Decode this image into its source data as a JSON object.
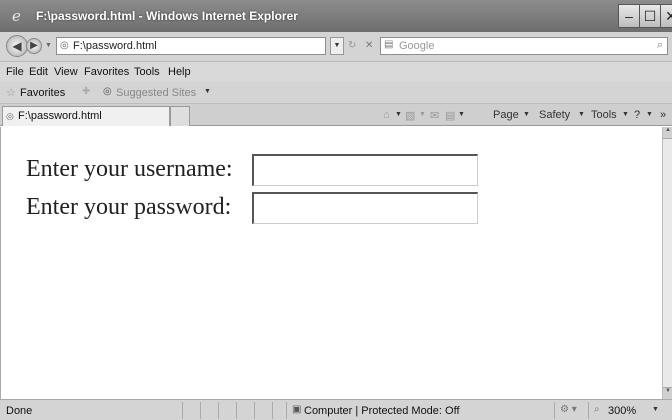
{
  "window": {
    "title": "F:\\password.html - Windows Internet Explorer",
    "min_glyph": "–",
    "max_glyph": "☐",
    "close_glyph": "✕"
  },
  "address": {
    "url": "F:\\password.html",
    "search_placeholder": "Google"
  },
  "menu": {
    "items": [
      "File",
      "Edit",
      "View",
      "Favorites",
      "Tools",
      "Help"
    ]
  },
  "favorites": {
    "label": "Favorites",
    "suggested": "Suggested Sites"
  },
  "tab": {
    "label": "F:\\password.html"
  },
  "commandbar": {
    "page": "Page",
    "safety": "Safety",
    "tools": "Tools"
  },
  "form": {
    "username_label": "Enter your username:",
    "password_label": "Enter your password:",
    "username_value": "",
    "password_value": ""
  },
  "status": {
    "text": "Done",
    "zone": "Computer | Protected Mode: Off",
    "zoom": "300%"
  },
  "icons": {
    "app": "ie-logo-icon",
    "back": "back-arrow-icon",
    "forward": "forward-arrow-icon",
    "refresh": "refresh-icon",
    "stop": "stop-icon",
    "search": "search-icon",
    "favorites": "star-icon",
    "home": "home-icon",
    "help": "help-icon",
    "zone": "computer-icon",
    "zoom": "zoom-icon"
  }
}
